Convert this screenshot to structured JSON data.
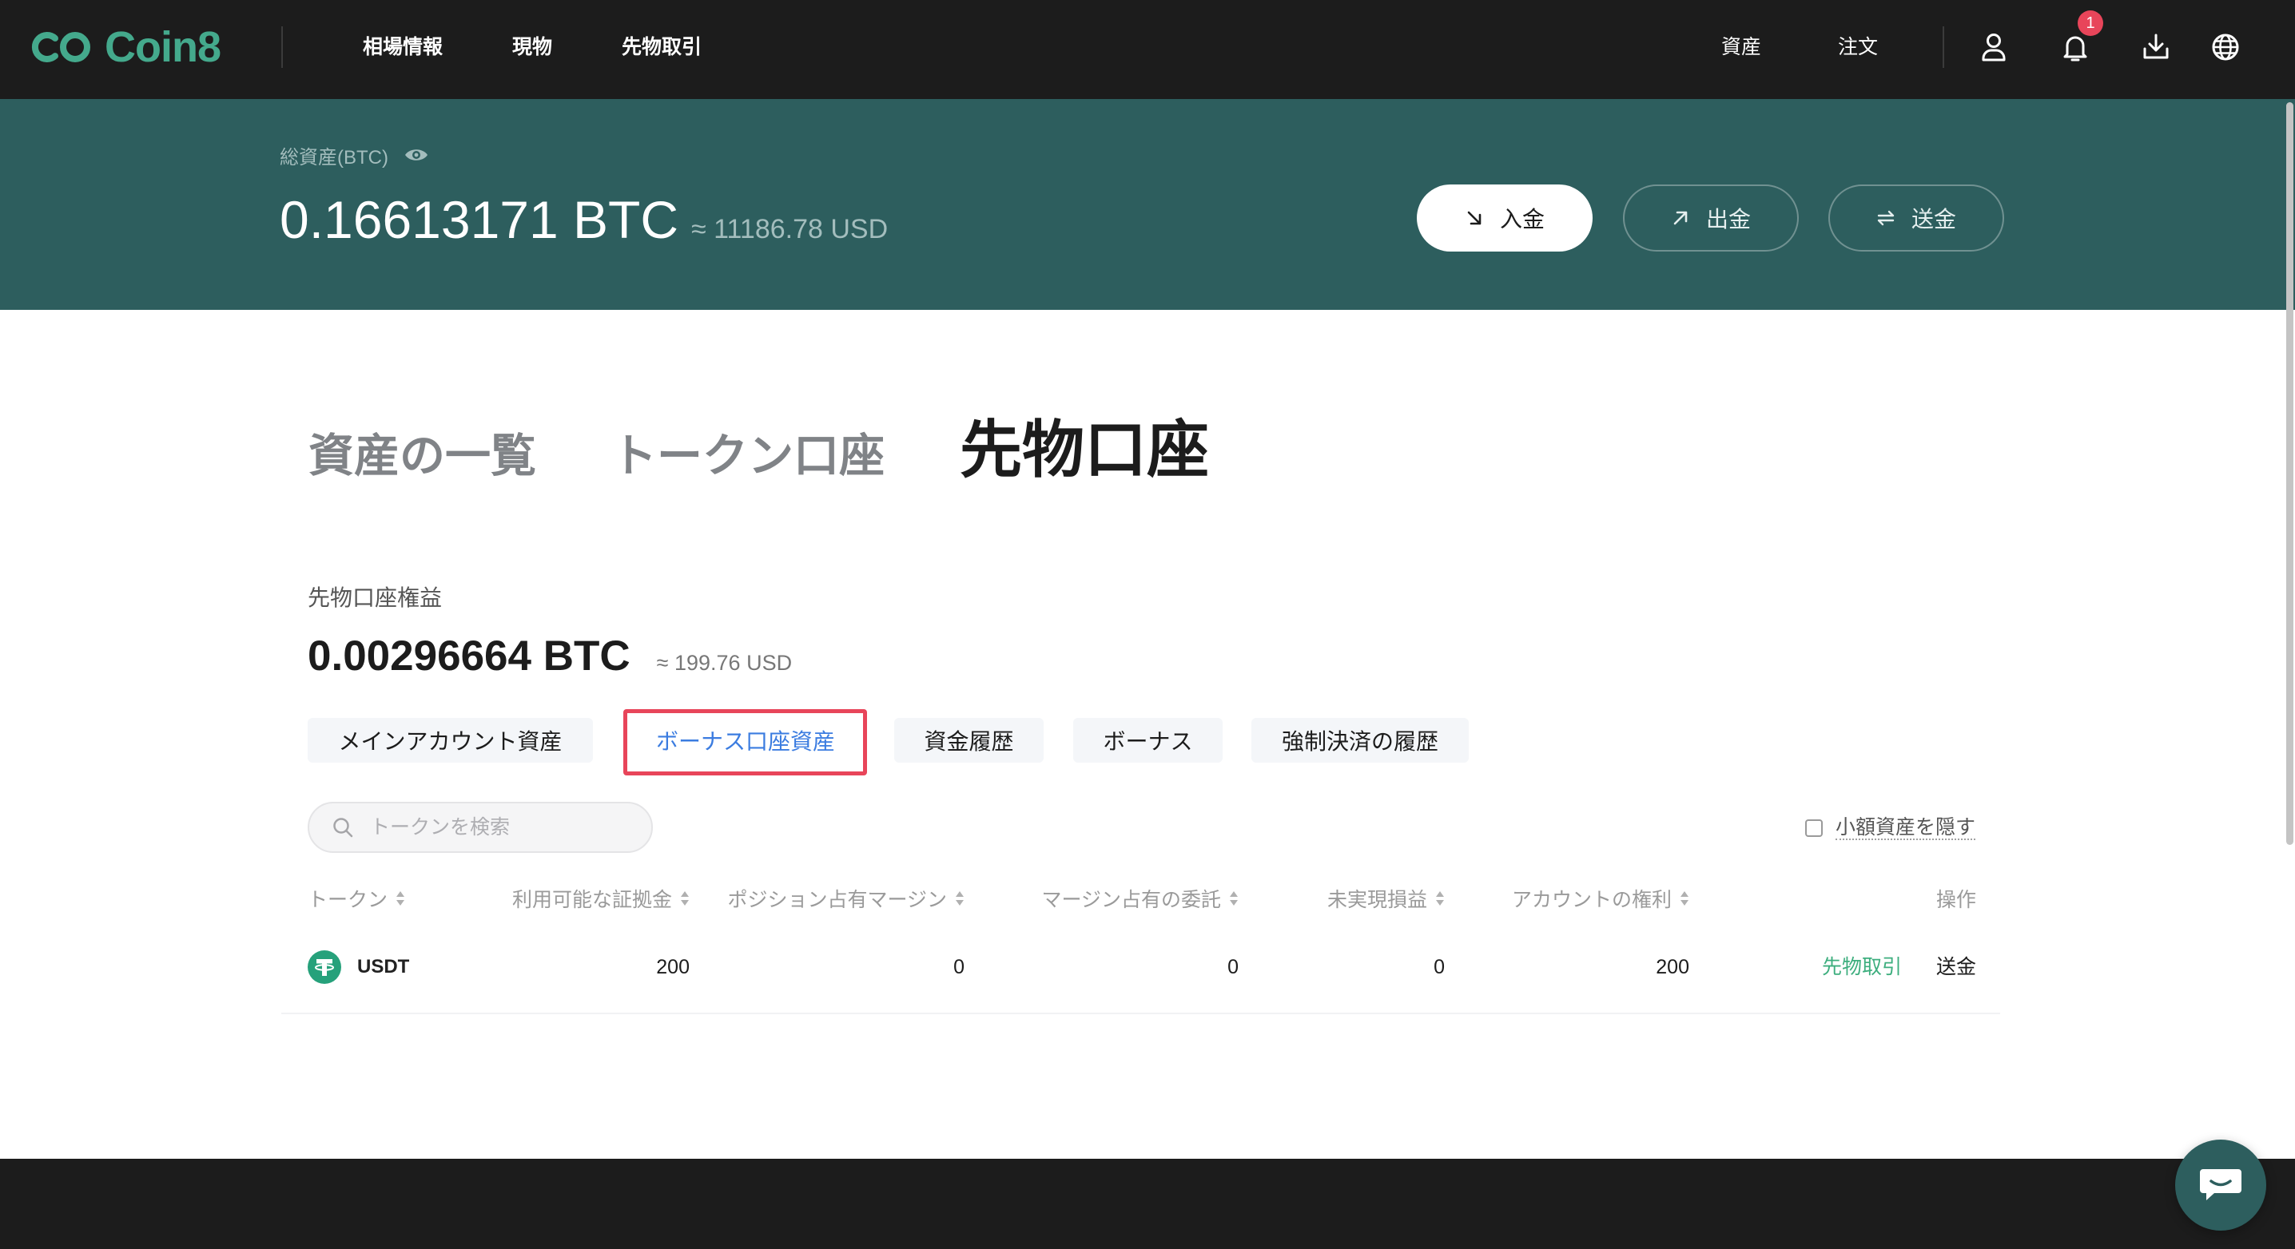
{
  "colors": {
    "nav_bg": "#1c1c1c",
    "logo": "#44a98c",
    "banner_bg": "#2d5e5e",
    "banner_muted": "#a3bdbd",
    "link_blue": "#3b7ce0",
    "action_green": "#3dae7e",
    "highlight_red": "#e8455a",
    "badge_red": "#e8455a",
    "usdt": "#26a17b"
  },
  "nav": {
    "logo_text": "Coin8",
    "menu": [
      {
        "label": "相場情報"
      },
      {
        "label": "現物"
      },
      {
        "label": "先物取引"
      }
    ],
    "right_menu": [
      {
        "label": "資産"
      },
      {
        "label": "注文"
      }
    ],
    "icons": [
      "user-icon",
      "bell-icon",
      "download-icon",
      "globe-icon"
    ],
    "notification_count": "1"
  },
  "banner": {
    "total_label": "総資産(BTC)",
    "total_btc": "0.16613171 BTC",
    "total_usd": "≈ 11186.78 USD",
    "deposit_label": "入金",
    "withdraw_label": "出金",
    "transfer_label": "送金"
  },
  "tabs": [
    {
      "label": "資産の一覧",
      "active": false
    },
    {
      "label": "トークン口座",
      "active": false
    },
    {
      "label": "先物口座",
      "active": true
    }
  ],
  "futures": {
    "equity_label": "先物口座権益",
    "equity_btc": "0.00296664 BTC",
    "equity_usd": "≈ 199.76 USD",
    "subtabs": [
      {
        "label": "メインアカウント資産",
        "active": false
      },
      {
        "label": "ボーナス口座資産",
        "active": true
      },
      {
        "label": "資金履歴",
        "active": false
      },
      {
        "label": "ボーナス",
        "active": false
      },
      {
        "label": "強制決済の履歴",
        "active": false
      }
    ],
    "search_placeholder": "トークンを検索",
    "hide_small_label": "小額資産を隠す",
    "hide_small_checked": false,
    "table": {
      "headers": [
        "トークン",
        "利用可能な証拠金",
        "ポジション占有マージン",
        "マージン占有の委託",
        "未実現損益",
        "アカウントの権利",
        "操作"
      ],
      "rows": [
        {
          "token": "USDT",
          "available_margin": "200",
          "position_margin": "0",
          "order_margin": "0",
          "unrealized_pnl": "0",
          "account_equity": "200",
          "actions": [
            "先物取引",
            "送金"
          ]
        }
      ]
    }
  }
}
